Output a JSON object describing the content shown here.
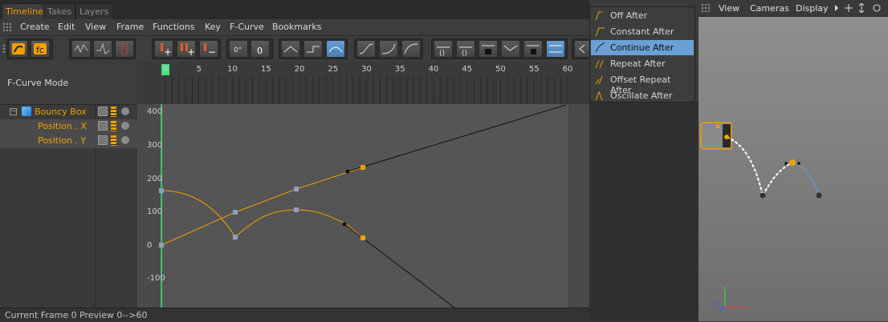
{
  "tabs": [
    {
      "label": "Timeline",
      "active": true
    },
    {
      "label": "Takes",
      "active": false
    },
    {
      "label": "Layers",
      "active": false
    }
  ],
  "menubar": [
    "Create",
    "Edit",
    "View",
    "Frame",
    "Functions",
    "Key",
    "F-Curve",
    "Bookmarks"
  ],
  "mode_label": "F-Curve Mode",
  "objects": {
    "parent": "Bouncy Box",
    "tracks": [
      "Position . X",
      "Position . Y"
    ]
  },
  "ruler": {
    "frames": [
      "0",
      "5",
      "10",
      "15",
      "20",
      "25",
      "30",
      "35",
      "40",
      "45",
      "50",
      "55",
      "60"
    ],
    "current_frame": 0
  },
  "graph": {
    "y_labels": [
      "400",
      "300",
      "200",
      "100",
      "0",
      "-100"
    ]
  },
  "status": {
    "text": "Current Frame  0  Preview  0-->60"
  },
  "dropdown": {
    "items": [
      {
        "label": "Off After",
        "selected": false
      },
      {
        "label": "Constant After",
        "selected": false
      },
      {
        "label": "Continue After",
        "selected": true
      },
      {
        "label": "Repeat After",
        "selected": false
      },
      {
        "label": "Offset Repeat After",
        "selected": false
      },
      {
        "label": "Oscillate After",
        "selected": false
      }
    ]
  },
  "viewport": {
    "menus": [
      "View",
      "Cameras",
      "Display"
    ],
    "axes": {
      "y": "Y",
      "z": "Z",
      "x": "X"
    }
  },
  "colors": {
    "accent": "#f0a000",
    "selection": "#6aa0d6",
    "current_frame_marker": "#4ade80"
  }
}
